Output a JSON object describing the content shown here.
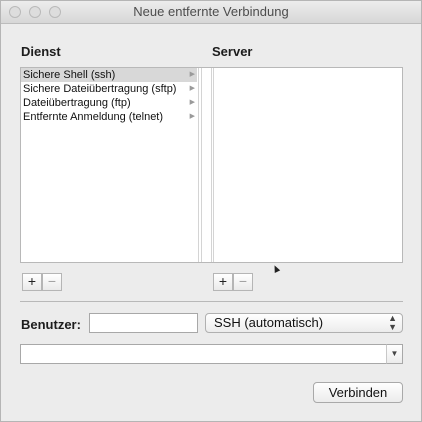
{
  "window": {
    "title": "Neue entfernte Verbindung"
  },
  "service": {
    "header": "Dienst",
    "items": [
      {
        "label": "Sichere Shell (ssh)",
        "selected": true
      },
      {
        "label": "Sichere Dateiübertragung (sftp)",
        "selected": false
      },
      {
        "label": "Dateiübertragung (ftp)",
        "selected": false
      },
      {
        "label": "Entfernte Anmeldung (telnet)",
        "selected": false
      }
    ],
    "add_label": "+",
    "remove_label": "−"
  },
  "server": {
    "header": "Server",
    "items": [],
    "add_label": "+",
    "remove_label": "−"
  },
  "user": {
    "label": "Benutzer:",
    "value": "",
    "protocol_selected": "SSH (automatisch)"
  },
  "command": {
    "value": ""
  },
  "actions": {
    "connect_label": "Verbinden"
  },
  "icons": {
    "row_arrow": "disclosure-arrow-icon",
    "popup": "up-down-chevron-icon",
    "combo": "down-triangle-icon"
  }
}
